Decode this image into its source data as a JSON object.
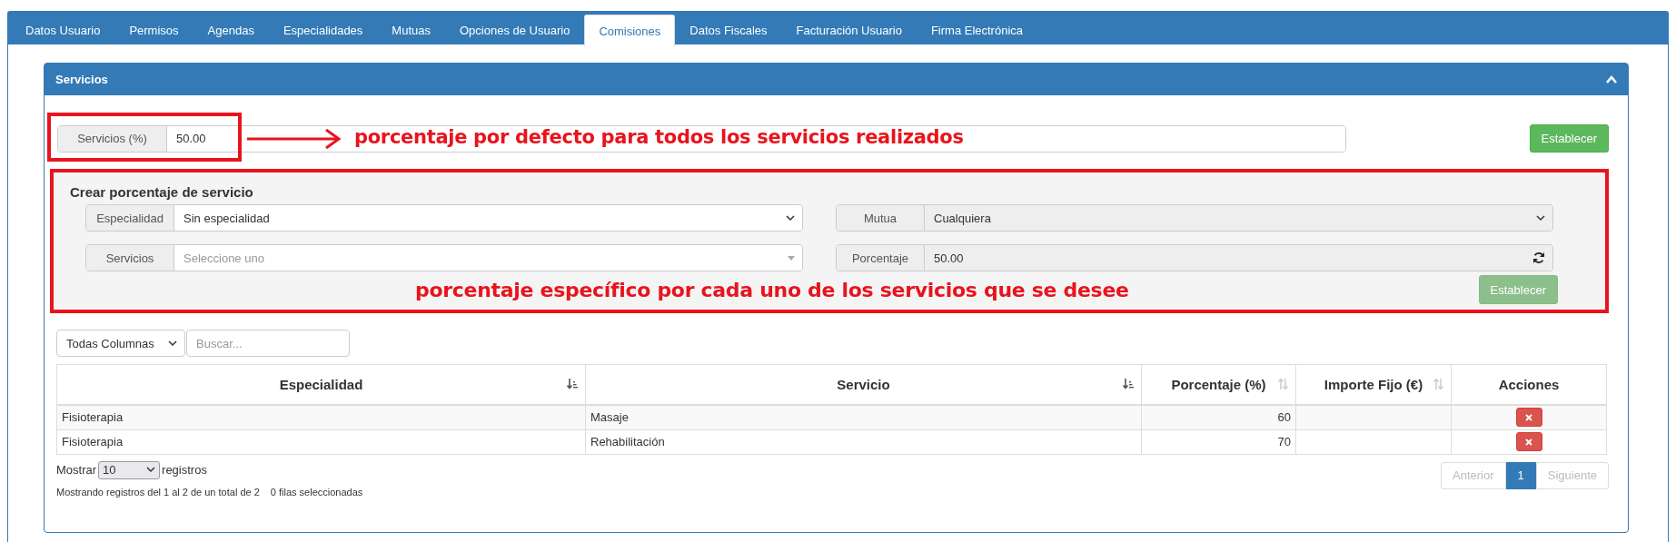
{
  "tabs": [
    {
      "label": "Datos Usuario",
      "selected": false
    },
    {
      "label": "Permisos",
      "selected": false
    },
    {
      "label": "Agendas",
      "selected": false
    },
    {
      "label": "Especialidades",
      "selected": false
    },
    {
      "label": "Mutuas",
      "selected": false
    },
    {
      "label": "Opciones de Usuario",
      "selected": false
    },
    {
      "label": "Comisiones",
      "selected": true
    },
    {
      "label": "Datos Fiscales",
      "selected": false
    },
    {
      "label": "Facturación Usuario",
      "selected": false
    },
    {
      "label": "Firma Electrónica",
      "selected": false
    }
  ],
  "panel": {
    "title": "Servicios",
    "expanded": true,
    "default_rate": {
      "label": "Servicios (%)",
      "value": "50.00"
    },
    "default_note": "porcentaje por defecto para todos los servicios realizados",
    "set_button": {
      "label": "Establecer",
      "disabled": false
    },
    "create_form": {
      "title": "Crear porcentaje de servicio",
      "fields": [
        {
          "label": "Especialidad",
          "value": "Sin especialidad",
          "kind": "select",
          "disabled": false
        },
        {
          "label": "Mutua",
          "value": "Cualquiera",
          "kind": "select",
          "disabled": true
        },
        {
          "label": "Servicios",
          "placeholder": "Seleccione uno",
          "kind": "combo",
          "disabled": false
        },
        {
          "label": "Porcentaje",
          "value": "50.00",
          "kind": "refresh",
          "disabled": true
        }
      ],
      "note": "porcentaje específico por cada uno de los servicios que se desee",
      "button": {
        "label": "Establecer",
        "disabled": true
      }
    },
    "table": {
      "column_filter": "Todas Columnas",
      "search_placeholder": "Buscar...",
      "columns": [
        {
          "label": "Especialidad",
          "kind": "sorted"
        },
        {
          "label": "Servicio",
          "kind": "sorted"
        },
        {
          "label": "Porcentaje (%)",
          "kind": "sortable"
        },
        {
          "label": "Importe Fijo (€)",
          "kind": "sortable"
        },
        {
          "label": "Acciones",
          "kind": "plain"
        }
      ],
      "rows": [
        {
          "especialidad": "Fisioterapia",
          "servicio": "Masaje",
          "porcentaje": "60"
        },
        {
          "especialidad": "Fisioterapia",
          "servicio": "Rehabilitación",
          "porcentaje": "70"
        }
      ],
      "length": {
        "prefix": "Mostrar",
        "value": "10",
        "suffix": "registros"
      },
      "info": "Mostrando registros del 1 al 2 de un total de 2",
      "selection_info": "0 filas seleccionadas",
      "pagination": {
        "previous": {
          "label": "Anterior",
          "disabled": true
        },
        "pages": [
          {
            "label": "1",
            "selected": true
          }
        ],
        "next": {
          "label": "Siguiente",
          "disabled": true
        }
      }
    }
  }
}
